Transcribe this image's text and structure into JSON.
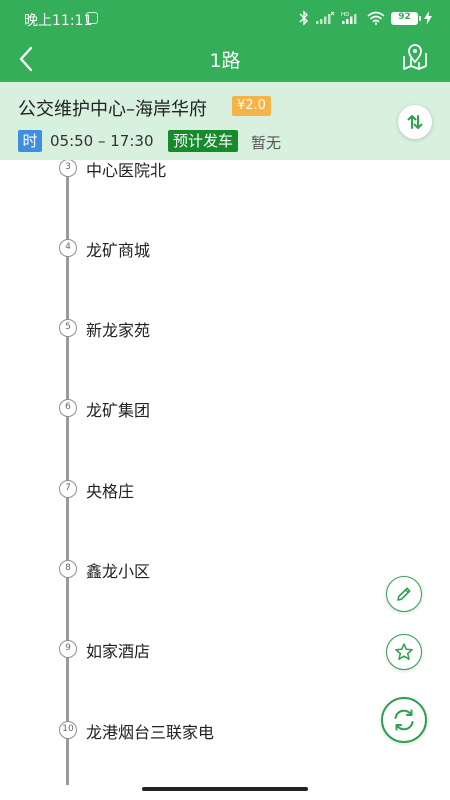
{
  "status_bar": {
    "time": "晚上11:11",
    "battery": "92",
    "network": "HD"
  },
  "nav": {
    "title": "1路"
  },
  "route": {
    "name": "公交维护中心–海岸华府",
    "fare": "¥2.0",
    "time_tag": "时",
    "hours": "05:50 – 17:30",
    "depart_tag": "预计发车",
    "depart_value": "暂无"
  },
  "stops": [
    {
      "num": "3",
      "name": "中心医院北"
    },
    {
      "num": "4",
      "name": "龙矿商城"
    },
    {
      "num": "5",
      "name": "新龙家苑"
    },
    {
      "num": "6",
      "name": "龙矿集团"
    },
    {
      "num": "7",
      "name": "央格庄"
    },
    {
      "num": "8",
      "name": "鑫龙小区"
    },
    {
      "num": "9",
      "name": "如家酒店"
    },
    {
      "num": "10",
      "name": "龙港烟台三联家电"
    }
  ],
  "icons": {
    "back": "chevron-left-icon",
    "map": "map-pin-icon",
    "swap": "swap-arrows-icon",
    "edit": "pencil-icon",
    "favorite": "star-icon",
    "refresh": "refresh-icon"
  },
  "colors": {
    "header": "#34ae59",
    "info_panel": "#d8f0de",
    "fare_badge": "#f7b347",
    "time_tag": "#3f8fe0",
    "depart_tag": "#178a2c"
  }
}
